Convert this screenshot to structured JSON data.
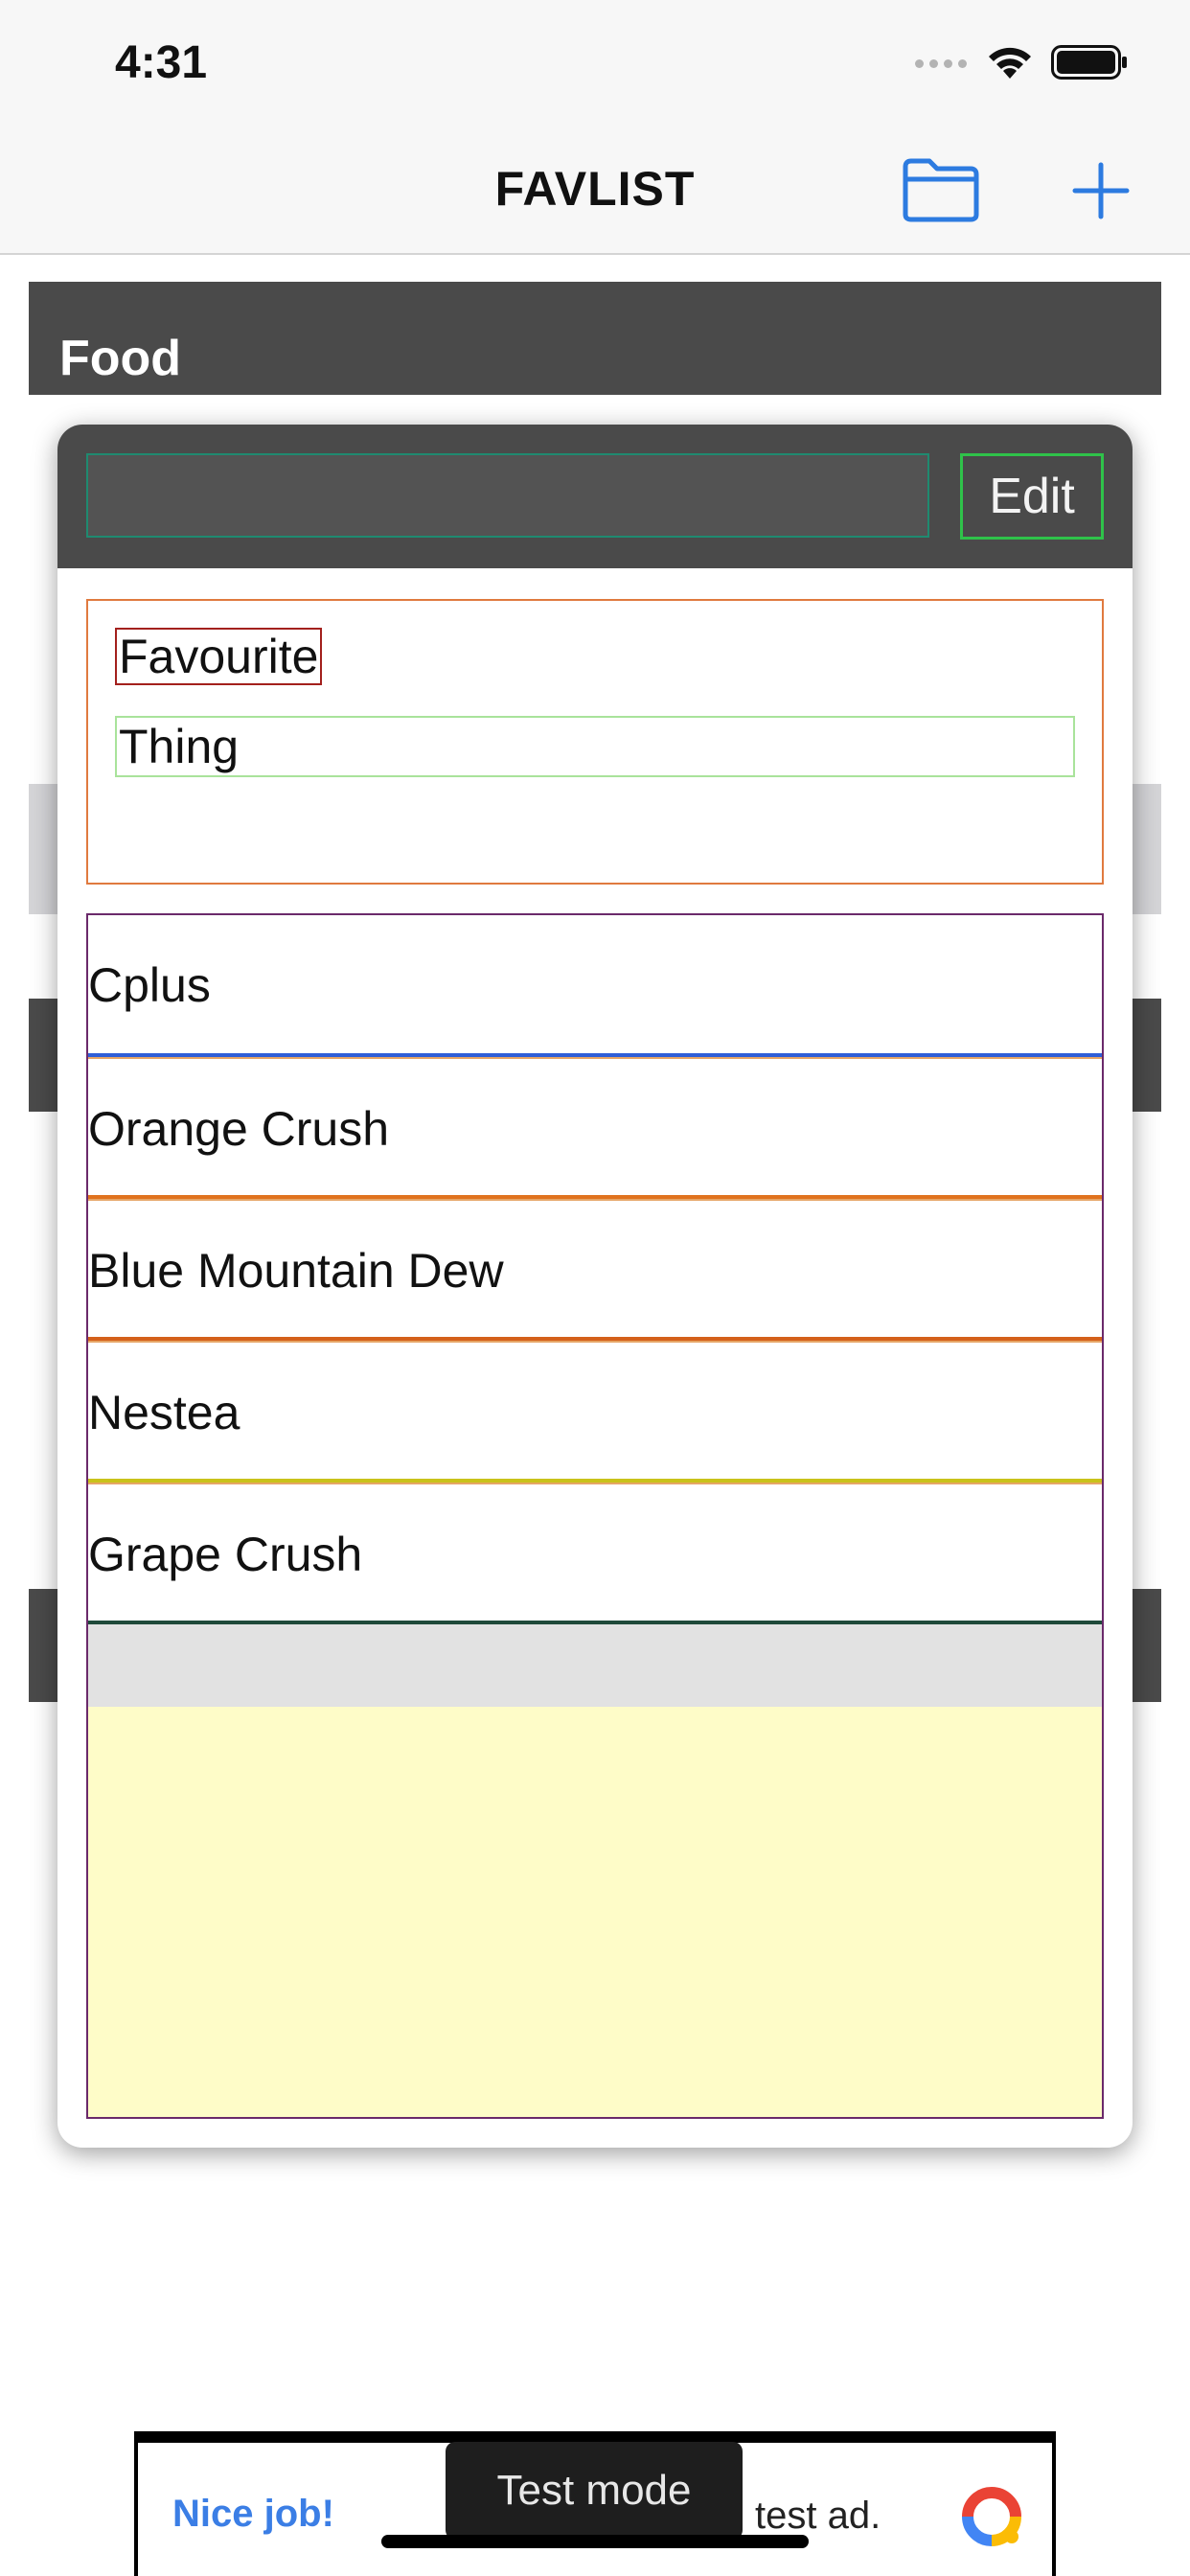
{
  "status_bar": {
    "time": "4:31"
  },
  "nav": {
    "title": "FAVLIST",
    "icons": [
      "folder-icon",
      "plus-icon"
    ],
    "accent_color": "#2d7be0"
  },
  "sections": [
    {
      "label": "Food"
    }
  ],
  "popup": {
    "search": {
      "value": "",
      "placeholder": ""
    },
    "edit_label": "Edit",
    "favourite_label": "Favourite",
    "thing_value": "Thing",
    "items": [
      {
        "label": "Cplus",
        "underline_color": "#2f5fd8"
      },
      {
        "label": "Orange Crush",
        "underline_color": "#e0721e"
      },
      {
        "label": "Blue Mountain Dew",
        "underline_color": "#d4601a"
      },
      {
        "label": "Nestea",
        "underline_color": "#c9c21a"
      },
      {
        "label": "Grape Crush",
        "underline_color": "#1f4a3a"
      }
    ]
  },
  "ad": {
    "nice_job": "Nice job!",
    "badge": "Test mode",
    "text": "test ad."
  }
}
